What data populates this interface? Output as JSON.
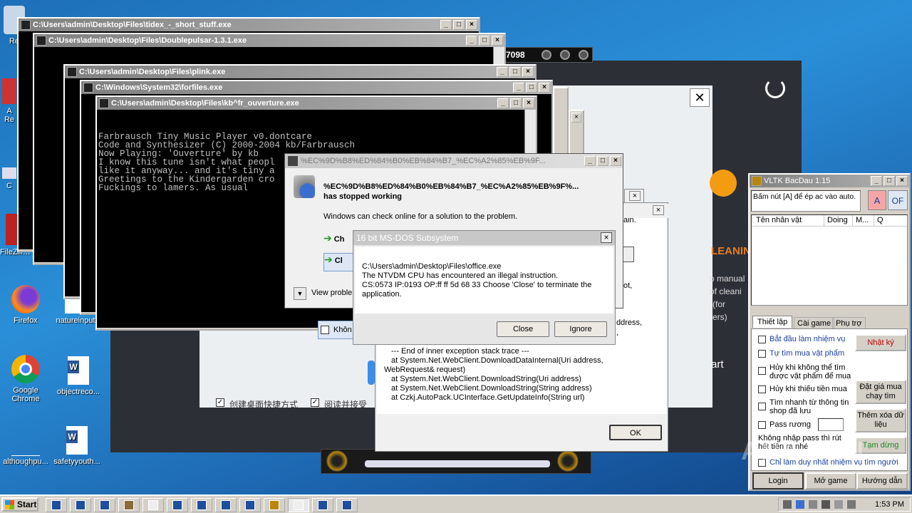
{
  "desktop_icons": [
    {
      "label": "Re"
    },
    {
      "label": "A\nRe"
    },
    {
      "label": "C"
    },
    {
      "label": "FileZilla C"
    },
    {
      "label": "Firefox"
    },
    {
      "label": "natureinput"
    },
    {
      "label": "Google Chrome"
    },
    {
      "label": "objectreco..."
    },
    {
      "label": "althoughpu..."
    },
    {
      "label": "safetyyouth..."
    }
  ],
  "windows": {
    "tidex_title": "C:\\Users\\admin\\Desktop\\Files\\tidex_-_short_stuff.exe",
    "doublepulsar_title": "C:\\Users\\admin\\Desktop\\Files\\Doublepulsar-1.3.1.exe",
    "plink_title": "C:\\Users\\admin\\Desktop\\Files\\plink.exe",
    "forfiles_title": "C:\\Windows\\System32\\forfiles.exe",
    "kb_title": "C:\\Users\\admin\\Desktop\\Files\\kb^fr_ouverture.exe",
    "kb_console_lines": [
      "Farbrausch Tiny Music Player v0.dontcare",
      "Code and Synthesizer (C) 2000-2004 kb/Farbrausch",
      "",
      "Now Playing: 'Ouverture' by kb",
      "",
      "I know this tune isn't what peopl",
      "like it anyway... and it's tiny a",
      "",
      "Greetings to the Kindergarden cro",
      "Fuckings to lamers. As usual"
    ],
    "player_counter": "7098"
  },
  "crash_dialog": {
    "title": "%EC%9D%B8%ED%84%B0%EB%84%B7_%EC%A2%85%EB%9F...",
    "heading": "%EC%9D%B8%ED%84%B0%EB%84%B7_%EC%A2%85%EB%9F%...",
    "heading2": "has stopped working",
    "body": "Windows can check online for a solution to the problem.",
    "option1": "Ch",
    "option2": "Cl",
    "view_problem": "View problem"
  },
  "ntvdm_dialog": {
    "title": "16 bit MS-DOS Subsystem",
    "path": "C:\\Users\\admin\\Desktop\\Files\\office.exe",
    "line1": "The NTVDM CPU has encountered an illegal instruction.",
    "line2": "CS:0573 IP:0193 OP:ff ff 5d 68 33 Choose 'Close' to terminate the",
    "line3": "application.",
    "close_label": "Close",
    "ignore_label": "Ignore"
  },
  "exception_dialog": {
    "partial_lines": [
      "ain.",
      "ot,",
      "ddress,",
      ","
    ],
    "stack": [
      "--- End of inner exception stack trace ---",
      "at System.Net.WebClient.DownloadDataInternal(Uri address,",
      "WebRequest& request)",
      "at System.Net.WebClient.DownloadString(Uri address)",
      "at System.Net.WebClient.DownloadString(String address)",
      "at Czkj.AutoPack.UCInterface.GetUpdateInfo(String url)"
    ],
    "ok_label": "OK",
    "khon_label": "Khôn"
  },
  "installer": {
    "checkbox1": "创建桌面快捷方式",
    "checkbox2": "阅读并接受",
    "cleaning_text": "LEANIN",
    "manual_lines": [
      "o manual",
      "of cleani",
      "(for",
      "ers)"
    ],
    "start_text": "art"
  },
  "vltk": {
    "title": "VLTK BacDau 1.15",
    "hint": "Bấm nút [A] để ép ac vào auto.",
    "btn_a": "A",
    "btn_of": "OF",
    "columns": [
      "Tên nhân vật",
      "Doing",
      "M...",
      "Q"
    ],
    "tabs": [
      "Thiết lập",
      "Cài game",
      "Phụ trợ"
    ],
    "options": [
      "Bắt đầu làm nhiệm vụ",
      "Tự tìm mua vật phẩm",
      "Hủy khi không thể tìm được vật phẩm để mua",
      "Hủy khi thiếu tiền mua",
      "Tìm nhanh từ thông tin shop đã lưu",
      "Pass rương"
    ],
    "pass_note": "Không nhập pass thì rút hết tiền ra nhé",
    "only_one": "Chỉ làm duy nhất nhiệm vụ tìm người",
    "side_buttons": [
      "Nhật ký",
      "Đặt giá mua chạy tìm",
      "Thêm xóa dữ liệu",
      "Tạm dừng"
    ],
    "bottom_buttons": [
      "Login",
      "Mở game",
      "Hướng dẫn"
    ]
  },
  "watermark": "ANY.RUN",
  "taskbar": {
    "start_label": "Start",
    "clock": "1:53 PM"
  }
}
